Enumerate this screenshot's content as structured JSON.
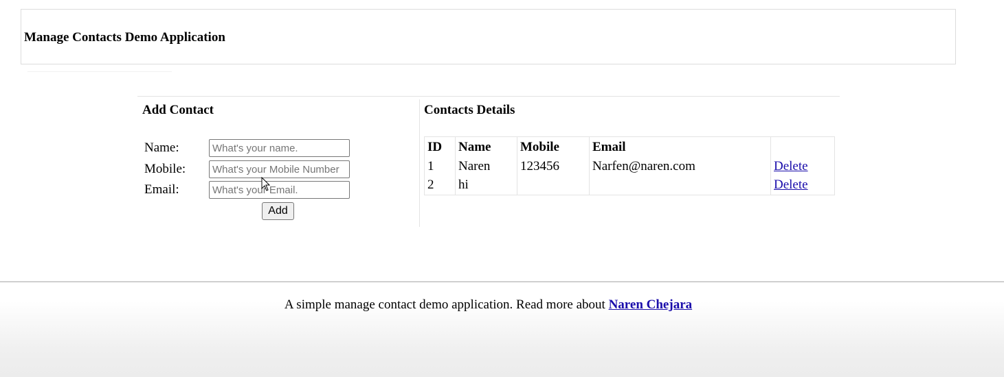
{
  "header": {
    "title": "Manage Contacts Demo Application"
  },
  "add_contact": {
    "title": "Add Contact",
    "fields": [
      {
        "label": "Name:",
        "placeholder": "What's your name.",
        "value": ""
      },
      {
        "label": "Mobile:",
        "placeholder": "What's your Mobile Number",
        "value": ""
      },
      {
        "label": "Email:",
        "placeholder": "What's your Email.",
        "value": ""
      }
    ],
    "add_button_label": "Add"
  },
  "contacts": {
    "title": "Contacts Details",
    "columns": [
      "ID",
      "Name",
      "Mobile",
      "Email",
      ""
    ],
    "rows": [
      {
        "id": "1",
        "name": "Naren",
        "mobile": "123456",
        "email": "Narfen@naren.com",
        "action": "Delete"
      },
      {
        "id": "2",
        "name": "hi",
        "mobile": "",
        "email": "",
        "action": "Delete"
      }
    ]
  },
  "footer": {
    "text": "A simple manage contact demo application. Read more about",
    "link_text": "Naren Chejara"
  },
  "colors": {
    "link": "#1a0dab",
    "border": "#e3e3e3"
  },
  "icons": [
    "mouse-cursor-icon"
  ]
}
